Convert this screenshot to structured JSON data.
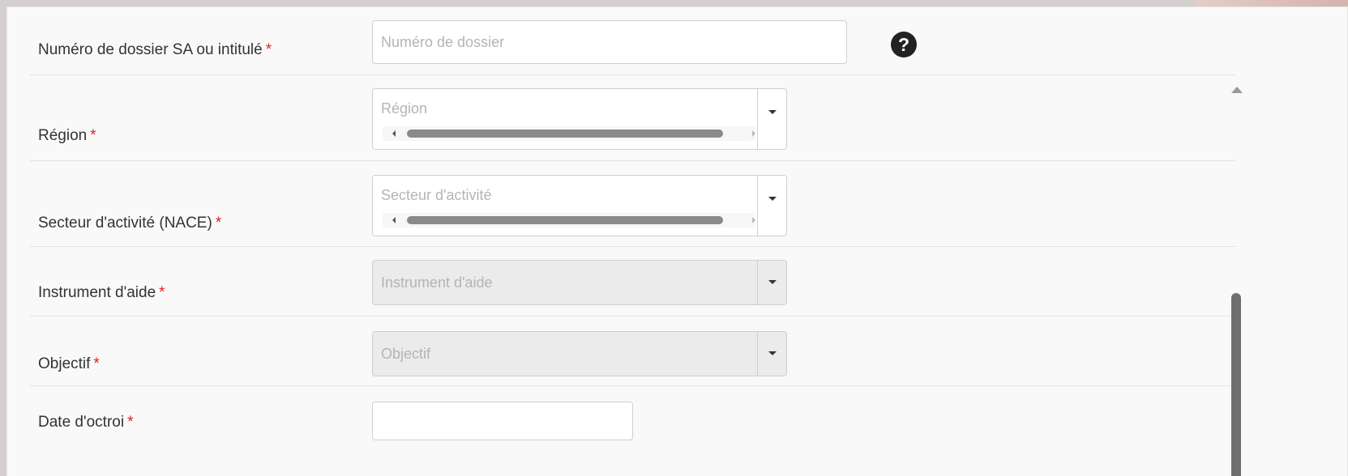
{
  "form": {
    "dossier": {
      "label": "Numéro de dossier SA ou intitulé",
      "required": "*",
      "placeholder": "Numéro de dossier",
      "help_icon": "question-circle-icon",
      "help_glyph": "?"
    },
    "region": {
      "label": "Région",
      "required": "*",
      "placeholder": "Région"
    },
    "secteur": {
      "label": "Secteur d'activité (NACE)",
      "required": "*",
      "placeholder": "Secteur d'activité"
    },
    "instrument": {
      "label": "Instrument d'aide",
      "required": "*",
      "placeholder": "Instrument d'aide"
    },
    "objectif": {
      "label": "Objectif",
      "required": "*",
      "placeholder": "Objectif"
    },
    "date": {
      "label": "Date d'octroi",
      "required": "*",
      "value": ""
    }
  },
  "colors": {
    "required": "#e02020",
    "placeholder": "#b4b4b4",
    "disabled_bg": "#ebebeb"
  }
}
